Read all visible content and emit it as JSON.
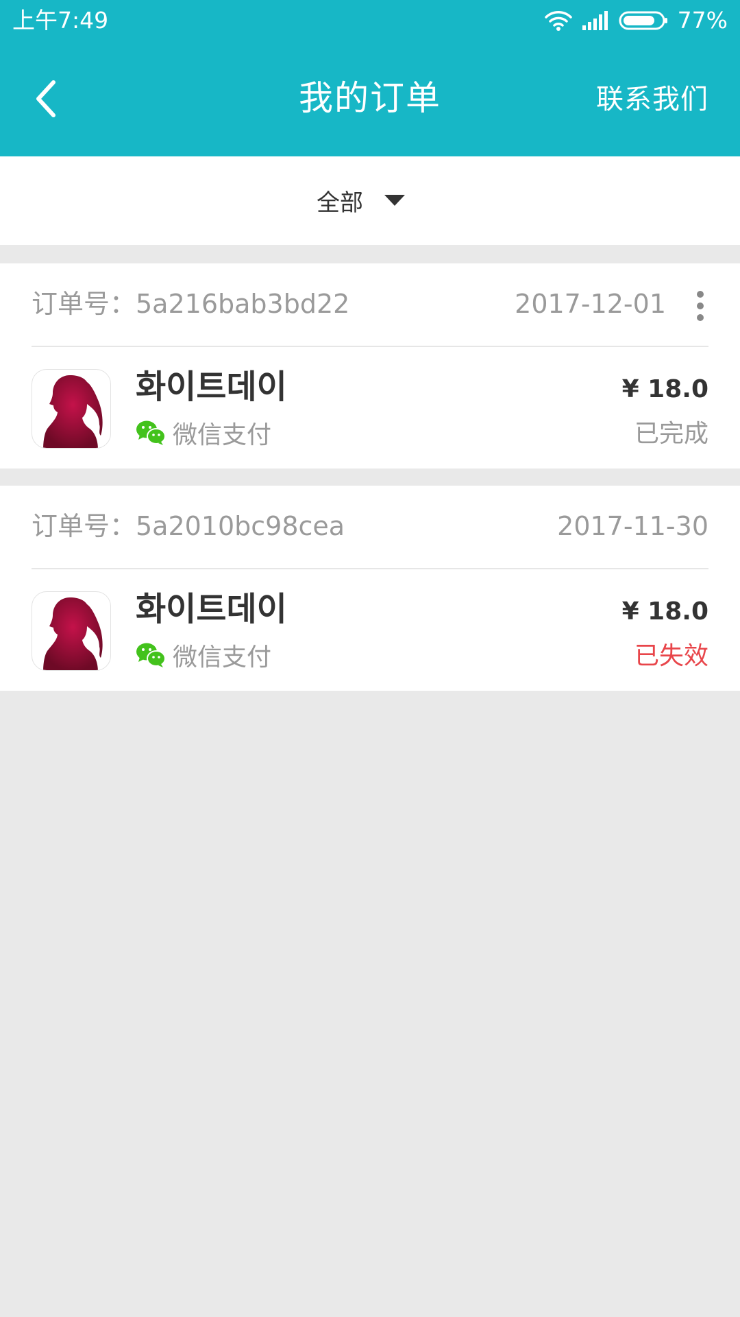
{
  "status_bar": {
    "time": "上午7:49",
    "battery": "77%",
    "icons": [
      "wifi-icon",
      "signal-icon",
      "battery-icon"
    ]
  },
  "header": {
    "title": "我的订单",
    "contact": "联系我们",
    "back_icon": "back-arrow-icon"
  },
  "filter": {
    "label": "全部",
    "icon": "dropdown-caret-icon"
  },
  "orders": [
    {
      "order_no": "订单号：5a216bab3bd22",
      "date": "2017-12-01",
      "app_name": "화이트데이",
      "payment": "微信支付",
      "price": "¥ 18.0",
      "status": "已完成",
      "status_color": "#999999",
      "has_menu": true
    },
    {
      "order_no": "订单号：5a2010bc98cea",
      "date": "2017-11-30",
      "app_name": "화이트데이",
      "payment": "微信支付",
      "price": "¥ 18.0",
      "status": "已失效",
      "status_color": "#e8454a",
      "has_menu": false
    }
  ],
  "colors": {
    "header_bg": "#17b7c6",
    "page_bg": "#e9e9e9",
    "wechat_green": "#43c21c",
    "failed_red": "#e8454a"
  }
}
